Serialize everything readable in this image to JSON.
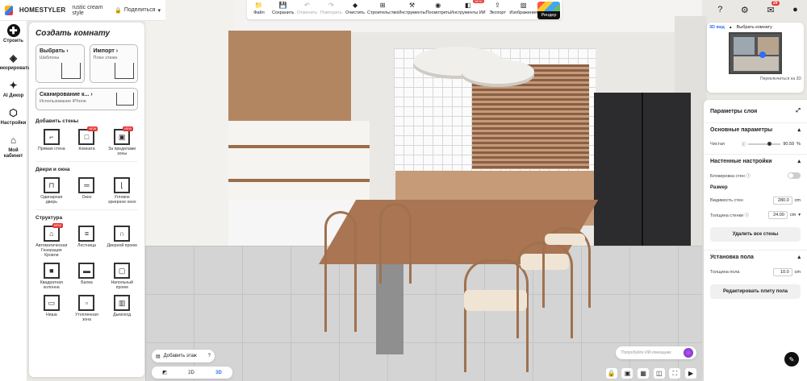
{
  "app": {
    "brand": "HOMESTYLER",
    "project_name": "rustic cream style",
    "share_label": "Поделиться"
  },
  "toolbar": {
    "items": [
      {
        "label": "Файл",
        "icon": "folder-icon",
        "disabled": false,
        "badge": ""
      },
      {
        "label": "Сохранить",
        "icon": "save-icon",
        "disabled": false,
        "badge": ""
      },
      {
        "label": "Отменить",
        "icon": "undo-icon",
        "disabled": true,
        "badge": ""
      },
      {
        "label": "Повторить",
        "icon": "redo-icon",
        "disabled": true,
        "badge": ""
      },
      {
        "label": "Очистить",
        "icon": "eraser-icon",
        "disabled": false,
        "badge": ""
      },
      {
        "label": "Строительство",
        "icon": "construction-icon",
        "disabled": false,
        "badge": ""
      },
      {
        "label": "Инструменты",
        "icon": "tools-icon",
        "disabled": false,
        "badge": ""
      },
      {
        "label": "Посмотреть",
        "icon": "eye-icon",
        "disabled": false,
        "badge": ""
      },
      {
        "label": "Инструменты ИИ",
        "icon": "ai-tools-icon",
        "disabled": false,
        "badge": "NEW"
      },
      {
        "label": "Экспорт",
        "icon": "export-icon",
        "disabled": false,
        "badge": ""
      },
      {
        "label": "Изображения",
        "icon": "images-icon",
        "disabled": false,
        "badge": ""
      }
    ],
    "render_label": "Рендер"
  },
  "top_right": {
    "notifications_count": "29"
  },
  "rail": [
    {
      "label": "Строить",
      "icon": "build-icon",
      "active": true
    },
    {
      "label": "Декорировать",
      "icon": "decorate-icon",
      "active": false
    },
    {
      "label": "AI Декор",
      "icon": "ai-decor-icon",
      "active": false
    },
    {
      "label": "Настройки",
      "icon": "settings-cube-icon",
      "active": false
    },
    {
      "label": "Мой кабинет",
      "icon": "my-cabinet-icon",
      "active": false
    }
  ],
  "panel": {
    "title": "Создать комнату",
    "choose": {
      "title": "Выбрать",
      "sub": "Шаблоны"
    },
    "import": {
      "title": "Импорт",
      "sub": "План этажа"
    },
    "scan": {
      "title": "Сканирование к...",
      "sub": "Использование iPhone"
    },
    "sections": [
      {
        "title": "Добавить стены",
        "items": [
          {
            "label": "Прямая стена",
            "icon": "straight-wall-icon",
            "new": false
          },
          {
            "label": "Комната",
            "icon": "room-icon",
            "new": true
          },
          {
            "label": "За пределами зоны",
            "icon": "outside-zone-icon",
            "new": true
          }
        ]
      },
      {
        "title": "Двери и окна",
        "items": [
          {
            "label": "Одинарная дверь",
            "icon": "single-door-icon",
            "new": false
          },
          {
            "label": "Окно",
            "icon": "window-icon",
            "new": false
          },
          {
            "label": "Угловое эркерное окно",
            "icon": "corner-bay-window-icon",
            "new": false
          }
        ]
      },
      {
        "title": "Структура",
        "items": [
          {
            "label": "Автоматическая Генерация Кровли",
            "icon": "auto-roof-icon",
            "new": true
          },
          {
            "label": "Лестница",
            "icon": "staircase-icon",
            "new": false
          },
          {
            "label": "Дверной проем",
            "icon": "doorway-icon",
            "new": false
          },
          {
            "label": "Квадратная колонна",
            "icon": "square-column-icon",
            "new": false
          },
          {
            "label": "Балка",
            "icon": "beam-icon",
            "new": false
          },
          {
            "label": "Напольный проем",
            "icon": "floor-opening-icon",
            "new": false
          },
          {
            "label": "Ниша",
            "icon": "niche-icon",
            "new": false
          },
          {
            "label": "Утопленная зона",
            "icon": "sunken-zone-icon",
            "new": false
          },
          {
            "label": "Дымоход",
            "icon": "chimney-icon",
            "new": false
          }
        ]
      }
    ]
  },
  "bottom_left": {
    "add_floor": "Добавить этаж",
    "view_2d": "2D",
    "view_3d": "3D"
  },
  "ai_bar": {
    "placeholder": "Попробуйте ИИ-помощник"
  },
  "minimap": {
    "tab_3d": "3D вид",
    "tab_choose": "Выбрать комнату",
    "switch_label": "Переключиться на 3D"
  },
  "properties": {
    "title": "Параметры слоя",
    "basic": "Основные параметры",
    "clarity_label": "Чистая",
    "clarity_value": "90.59",
    "clarity_unit": "%",
    "wall_settings": "Настенные настройки",
    "lock_walls": "Блокировка стен",
    "size": "Размер",
    "wall_height_label": "Видимость стен",
    "wall_height_value": "280.0",
    "wall_thickness_label": "Толщина стенки",
    "wall_thickness_value": "24.00",
    "unit_cm": "cm",
    "delete_walls": "Удалить все стены",
    "floor_setting": "Установка пола",
    "floor_thickness_label": "Толщина пола",
    "floor_thickness_value": "10.0",
    "edit_floor": "Редактировать плиту пола"
  }
}
